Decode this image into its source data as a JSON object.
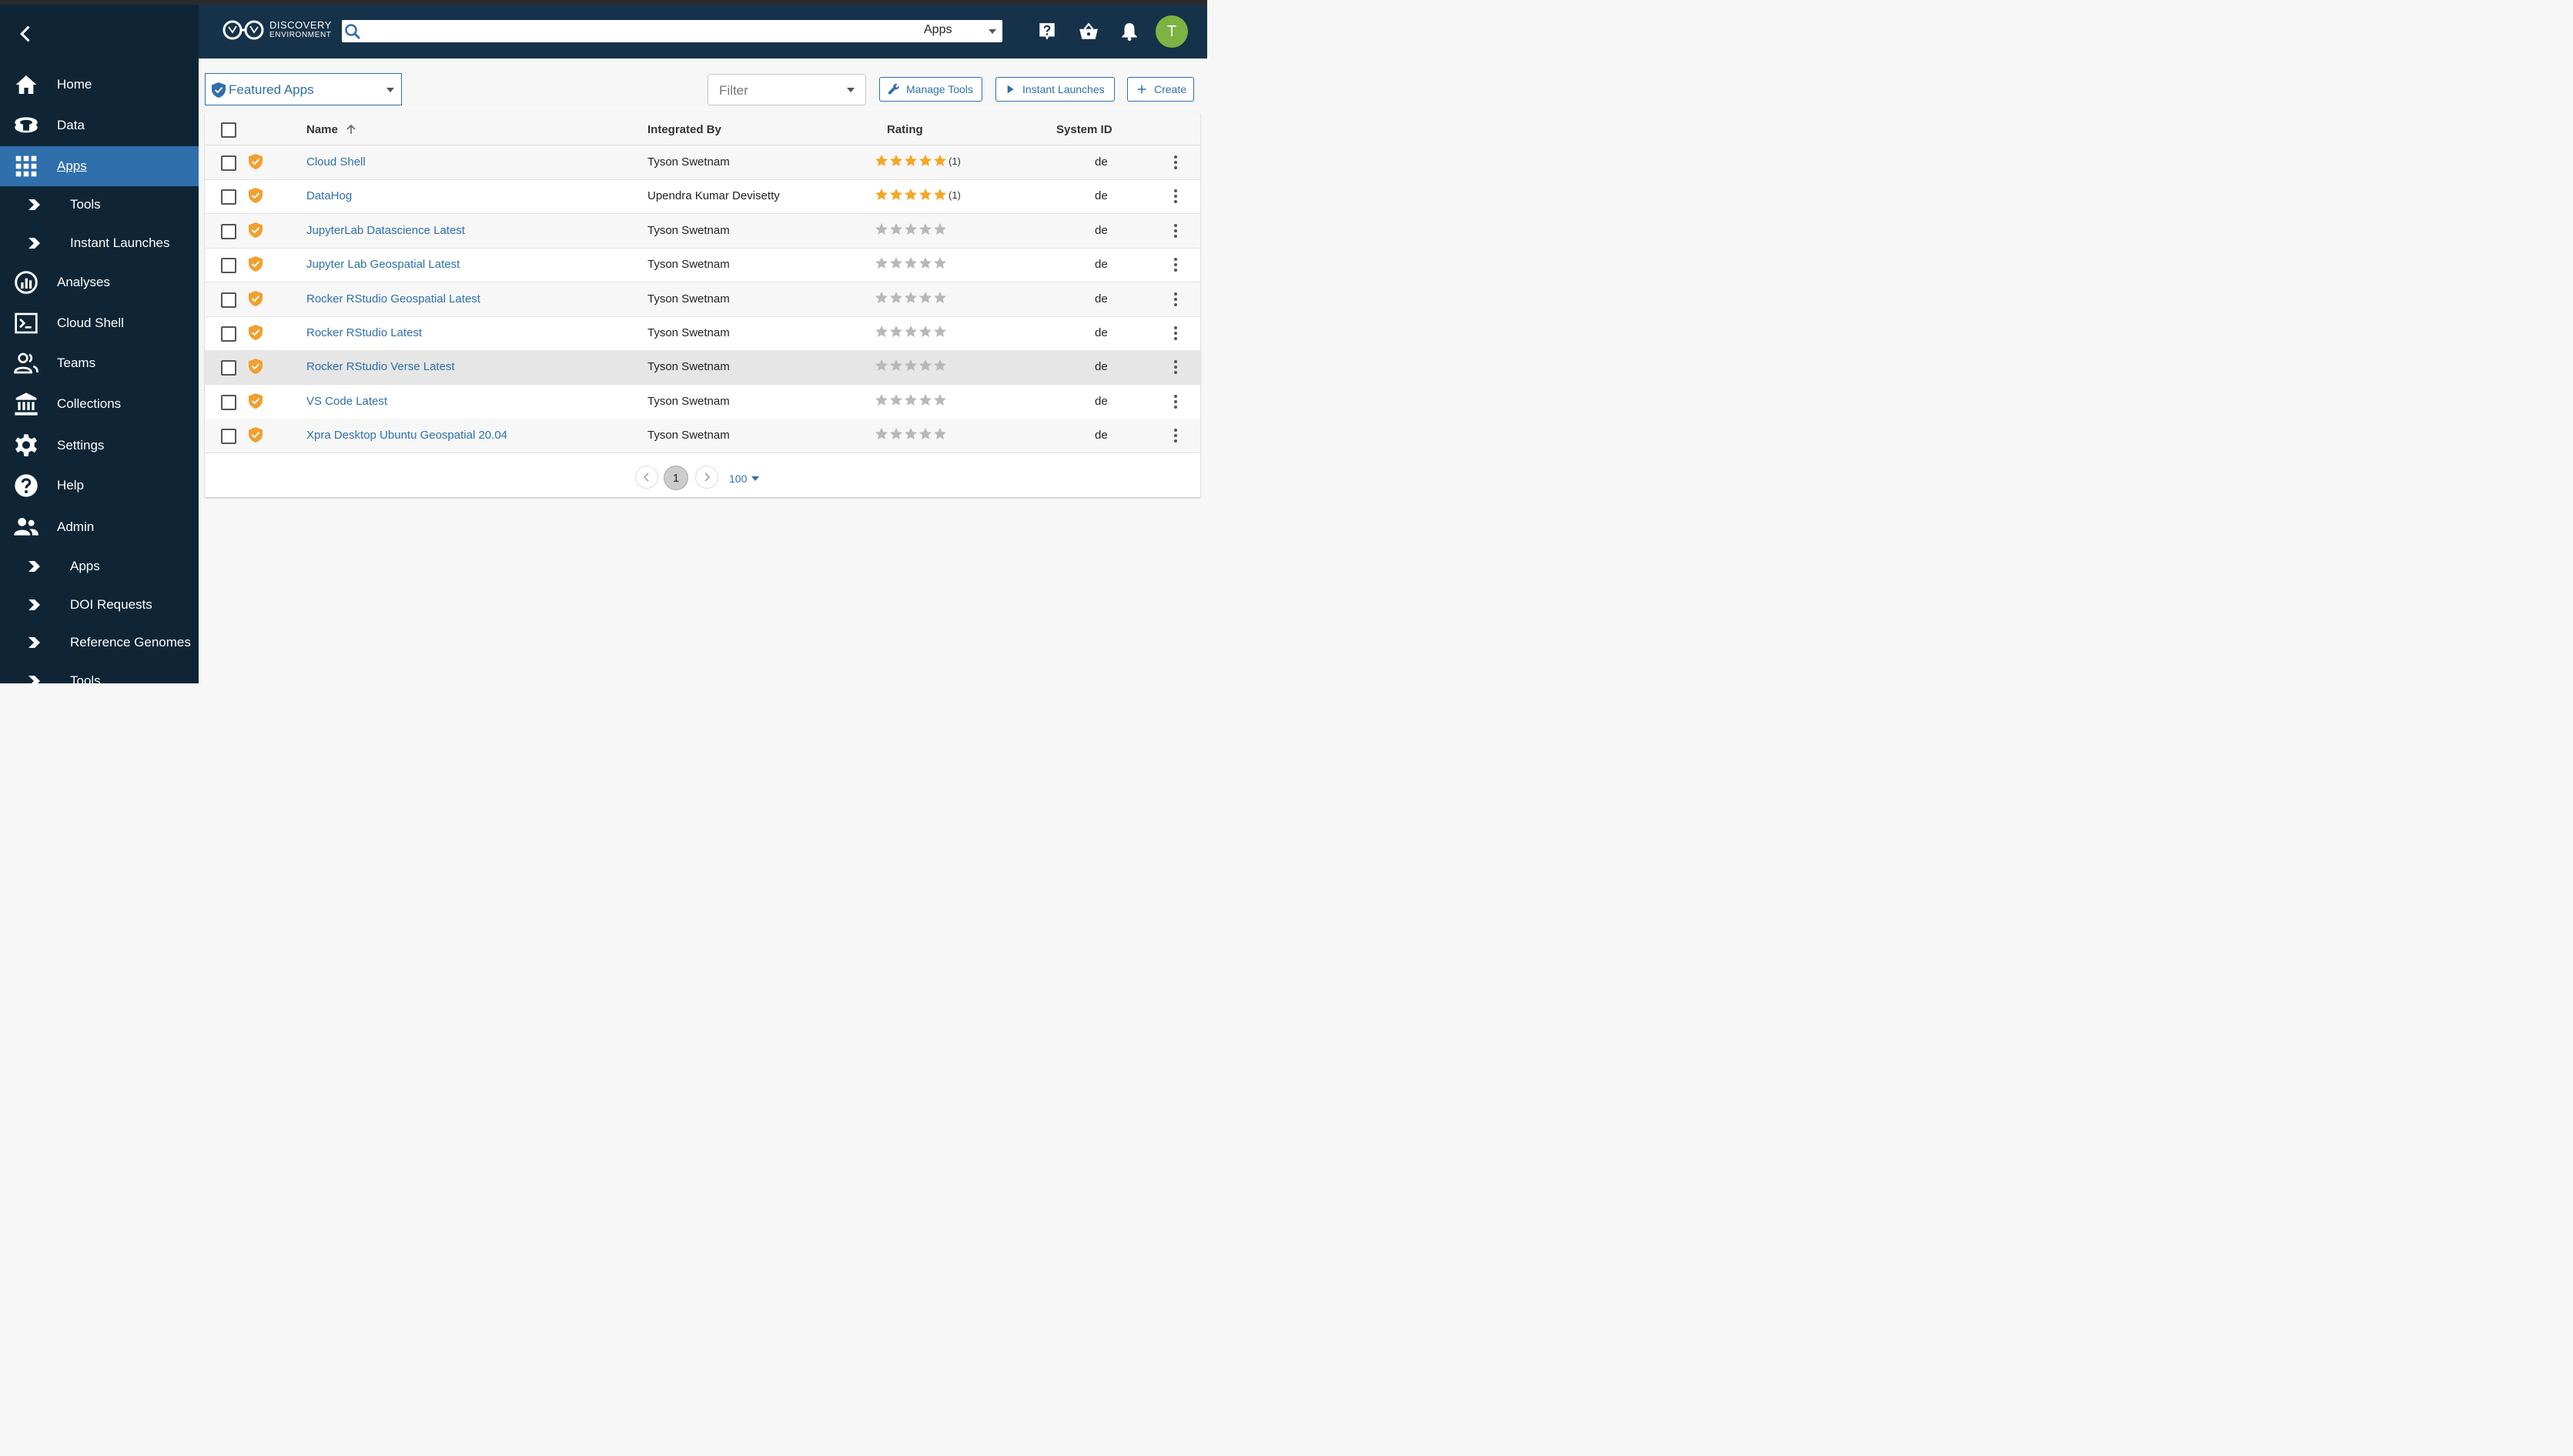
{
  "sidebar": {
    "items": [
      {
        "label": "Home",
        "icon": "home-icon"
      },
      {
        "label": "Data",
        "icon": "data-icon"
      },
      {
        "label": "Apps",
        "icon": "apps-grid-icon"
      },
      {
        "label": "Tools",
        "icon": "chevron-right-icon"
      },
      {
        "label": "Instant Launches",
        "icon": "chevron-right-icon"
      },
      {
        "label": "Analyses",
        "icon": "analyses-icon"
      },
      {
        "label": "Cloud Shell",
        "icon": "terminal-icon"
      },
      {
        "label": "Teams",
        "icon": "teams-icon"
      },
      {
        "label": "Collections",
        "icon": "collections-icon"
      },
      {
        "label": "Settings",
        "icon": "gear-icon"
      },
      {
        "label": "Help",
        "icon": "help-icon"
      },
      {
        "label": "Admin",
        "icon": "admin-icon"
      },
      {
        "label": "Apps",
        "icon": "chevron-right-icon"
      },
      {
        "label": "DOI Requests",
        "icon": "chevron-right-icon"
      },
      {
        "label": "Reference Genomes",
        "icon": "chevron-right-icon"
      },
      {
        "label": "Tools",
        "icon": "chevron-right-icon"
      }
    ]
  },
  "header": {
    "logo_line1": "DISCOVERY",
    "logo_line2": "ENVIRONMENT",
    "search_value": "",
    "search_scope": "Apps",
    "avatar_initial": "T"
  },
  "toolbar": {
    "view_label": "Featured Apps",
    "filter_placeholder": "Filter",
    "manage_tools": "Manage Tools",
    "instant_launches": "Instant Launches",
    "create": "Create"
  },
  "table": {
    "columns": {
      "name": "Name",
      "integrated_by": "Integrated By",
      "rating": "Rating",
      "system_id": "System ID"
    },
    "rows": [
      {
        "name": "Cloud Shell",
        "by": "Tyson Swetnam",
        "rating": 5,
        "rating_count": "(1)",
        "system": "de"
      },
      {
        "name": "DataHog",
        "by": "Upendra Kumar Devisetty",
        "rating": 5,
        "rating_count": "(1)",
        "system": "de"
      },
      {
        "name": "JupyterLab Datascience Latest",
        "by": "Tyson Swetnam",
        "rating": 0,
        "rating_count": "",
        "system": "de"
      },
      {
        "name": "Jupyter Lab Geospatial Latest",
        "by": "Tyson Swetnam",
        "rating": 0,
        "rating_count": "",
        "system": "de"
      },
      {
        "name": "Rocker RStudio Geospatial Latest",
        "by": "Tyson Swetnam",
        "rating": 0,
        "rating_count": "",
        "system": "de"
      },
      {
        "name": "Rocker RStudio Latest",
        "by": "Tyson Swetnam",
        "rating": 0,
        "rating_count": "",
        "system": "de"
      },
      {
        "name": "Rocker RStudio Verse Latest",
        "by": "Tyson Swetnam",
        "rating": 0,
        "rating_count": "",
        "system": "de"
      },
      {
        "name": "VS Code Latest",
        "by": "Tyson Swetnam",
        "rating": 0,
        "rating_count": "",
        "system": "de"
      },
      {
        "name": "Xpra Desktop Ubuntu Geospatial 20.04",
        "by": "Tyson Swetnam",
        "rating": 0,
        "rating_count": "",
        "system": "de"
      }
    ]
  },
  "pagination": {
    "current_page": "1",
    "page_size": "100"
  },
  "colors": {
    "sidebar_bg": "#0f2536",
    "header_bg": "#16324a",
    "accent": "#2f6fab",
    "star_filled": "#f5a623",
    "star_empty": "#b8b8b8",
    "shield": "#f0a030",
    "avatar": "#7cb342"
  }
}
